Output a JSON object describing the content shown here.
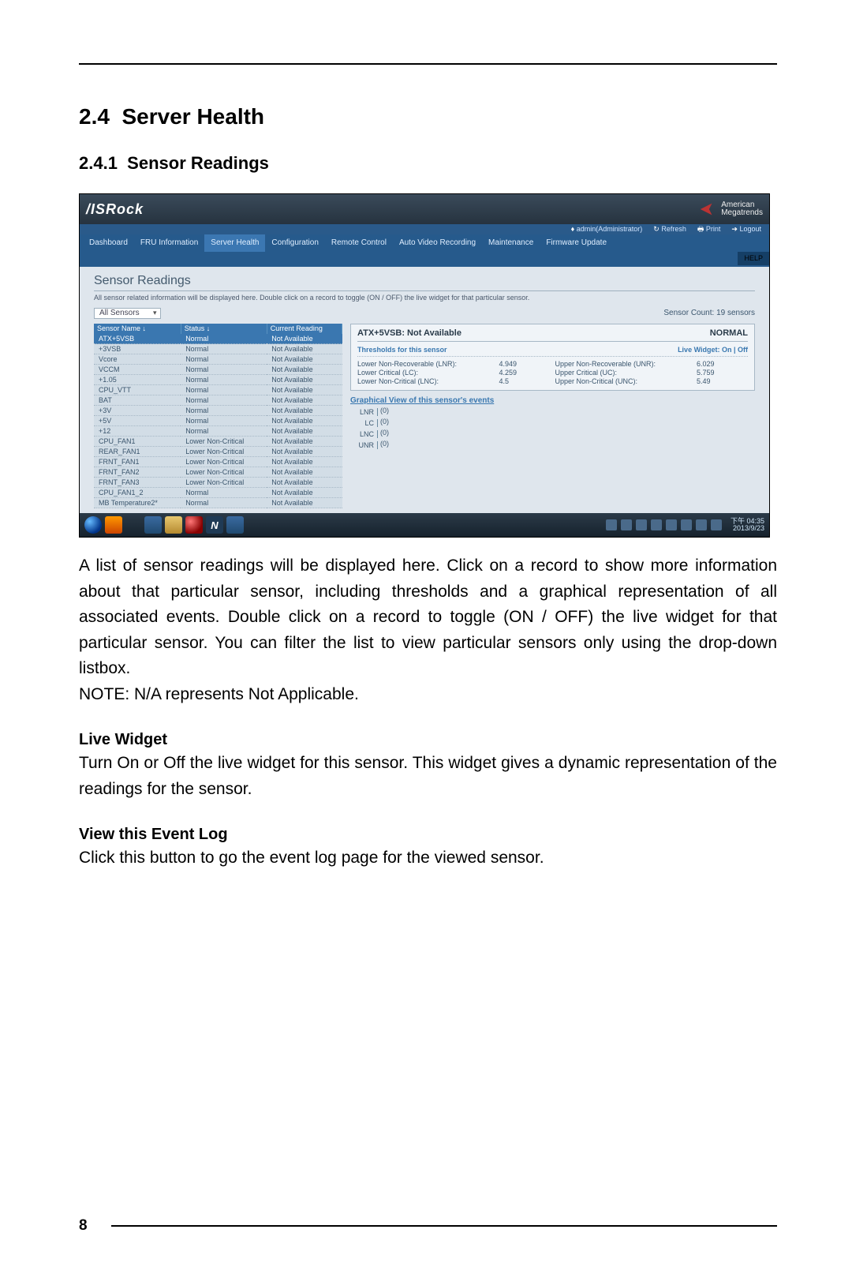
{
  "section": {
    "number": "2.4",
    "title": "Server Health",
    "sub_number": "2.4.1",
    "sub_title": "Sensor Readings"
  },
  "screenshot": {
    "brand": "/ISRock",
    "megatrends_line1": "American",
    "megatrends_line2": "Megatrends",
    "userbar": {
      "admin": "admin(Administrator)",
      "refresh": "Refresh",
      "print": "Print",
      "logout": "Logout"
    },
    "menu": [
      "Dashboard",
      "FRU Information",
      "Server Health",
      "Configuration",
      "Remote Control",
      "Auto Video Recording",
      "Maintenance",
      "Firmware Update"
    ],
    "help": "HELP",
    "page_title": "Sensor Readings",
    "page_desc": "All sensor related information will be displayed here. Double click on a record to toggle (ON / OFF) the live widget for that particular sensor.",
    "filter_label": "All Sensors",
    "sensor_count": "Sensor Count: 19 sensors",
    "table_headers": [
      "Sensor Name  ↓",
      "Status  ↓",
      "Current Reading"
    ],
    "sensors": [
      {
        "name": "ATX+5VSB",
        "status": "Normal",
        "reading": "Not Available"
      },
      {
        "name": "+3VSB",
        "status": "Normal",
        "reading": "Not Available"
      },
      {
        "name": "Vcore",
        "status": "Normal",
        "reading": "Not Available"
      },
      {
        "name": "VCCM",
        "status": "Normal",
        "reading": "Not Available"
      },
      {
        "name": "+1.05",
        "status": "Normal",
        "reading": "Not Available"
      },
      {
        "name": "CPU_VTT",
        "status": "Normal",
        "reading": "Not Available"
      },
      {
        "name": "BAT",
        "status": "Normal",
        "reading": "Not Available"
      },
      {
        "name": "+3V",
        "status": "Normal",
        "reading": "Not Available"
      },
      {
        "name": "+5V",
        "status": "Normal",
        "reading": "Not Available"
      },
      {
        "name": "+12",
        "status": "Normal",
        "reading": "Not Available"
      },
      {
        "name": "CPU_FAN1",
        "status": "Lower Non-Critical",
        "reading": "Not Available"
      },
      {
        "name": "REAR_FAN1",
        "status": "Lower Non-Critical",
        "reading": "Not Available"
      },
      {
        "name": "FRNT_FAN1",
        "status": "Lower Non-Critical",
        "reading": "Not Available"
      },
      {
        "name": "FRNT_FAN2",
        "status": "Lower Non-Critical",
        "reading": "Not Available"
      },
      {
        "name": "FRNT_FAN3",
        "status": "Lower Non-Critical",
        "reading": "Not Available"
      },
      {
        "name": "CPU_FAN1_2",
        "status": "Normal",
        "reading": "Not Available"
      },
      {
        "name": "MB Temperature2*",
        "status": "Normal",
        "reading": "Not Available"
      }
    ],
    "panel": {
      "name": "ATX+5VSB: Not Available",
      "status": "NORMAL",
      "thresh_title": "Thresholds for this sensor",
      "live_widget": "Live Widget:  On | Off",
      "thresholds": [
        [
          "Lower Non-Recoverable (LNR):",
          "4.949",
          "Upper Non-Recoverable (UNR):",
          "6.029"
        ],
        [
          "Lower Critical (LC):",
          "4.259",
          "Upper Critical (UC):",
          "5.759"
        ],
        [
          "Lower Non-Critical (LNC):",
          "4.5",
          "Upper Non-Critical (UNC):",
          "5.49"
        ]
      ],
      "graph_title": "Graphical View of this sensor's events",
      "bars": [
        {
          "label": "LNR",
          "val": "(0)"
        },
        {
          "label": "LC",
          "val": "(0)"
        },
        {
          "label": "LNC",
          "val": "(0)"
        },
        {
          "label": "UNR",
          "val": "(0)"
        }
      ]
    },
    "clock": {
      "time": "下午 04:35",
      "date": "2013/9/23"
    }
  },
  "body": {
    "para1": "A list of sensor readings will be displayed here. Click on a record to show more information about that particular sensor, including thresholds and a graphical representation of all associated events. Double click on a record to toggle (ON / OFF) the live widget for that particular sensor. You can filter the list to view particular sensors only using the drop-down listbox.",
    "note": "NOTE: N/A represents Not Applicable.",
    "live_widget_h": "Live Widget",
    "live_widget_p": "Turn On or Off the live widget for this sensor. This widget gives a dynamic representation of the readings for the sensor.",
    "view_log_h": "View this Event Log",
    "view_log_p": "Click this button to go the event log page for the viewed sensor."
  },
  "page_number": "8"
}
